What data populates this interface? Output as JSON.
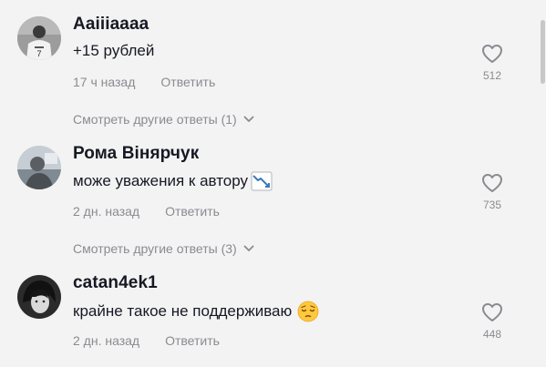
{
  "comments": [
    {
      "username": "Aaiiiaaaa",
      "text": "+15 рублей",
      "time": "17 ч назад",
      "reply_label": "Ответить",
      "likes": "512",
      "more_replies": "Смотреть другие ответы (1)"
    },
    {
      "username": "Рома Вінярчук",
      "text": "може уважения к автору",
      "emoji": "chart-decreasing-icon",
      "time": "2 дн. назад",
      "reply_label": "Ответить",
      "likes": "735",
      "more_replies": "Смотреть другие ответы (3)"
    },
    {
      "username": "catan4ek1",
      "text": "крайне такое не поддерживаю",
      "emoji": "pensive-face-icon",
      "time": "2 дн. назад",
      "reply_label": "Ответить",
      "likes": "448"
    }
  ],
  "colors": {
    "background": "#f3f3f3",
    "primary_text": "#161823",
    "secondary_text": "#8a8b91"
  }
}
